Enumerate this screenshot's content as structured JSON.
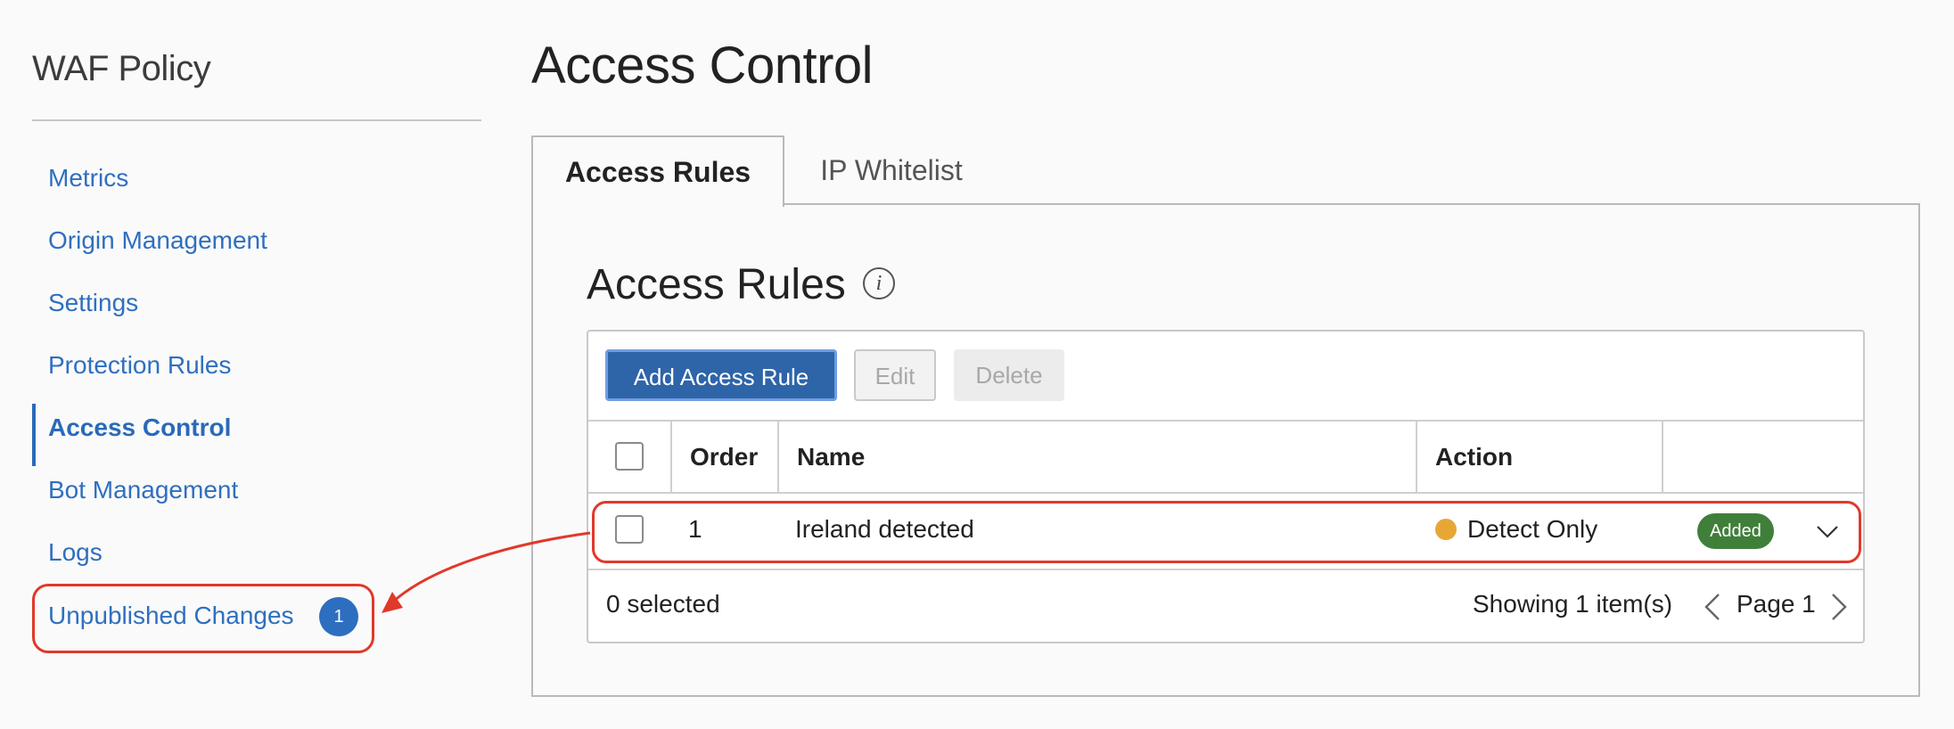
{
  "sidebar": {
    "title": "WAF Policy",
    "items": [
      {
        "label": "Metrics"
      },
      {
        "label": "Origin Management"
      },
      {
        "label": "Settings"
      },
      {
        "label": "Protection Rules"
      },
      {
        "label": "Access Control",
        "active": true
      },
      {
        "label": "Bot Management"
      },
      {
        "label": "Logs"
      }
    ],
    "unpublished": {
      "label": "Unpublished Changes",
      "count": "1"
    }
  },
  "main": {
    "title": "Access Control",
    "tabs": [
      {
        "label": "Access Rules",
        "active": true
      },
      {
        "label": "IP Whitelist"
      }
    ],
    "section_title": "Access Rules",
    "info_icon": "i",
    "toolbar": {
      "add_label": "Add Access Rule",
      "edit_label": "Edit",
      "delete_label": "Delete"
    },
    "table": {
      "columns": [
        "Order",
        "Name",
        "Action"
      ],
      "rows": [
        {
          "order": "1",
          "name": "Ireland detected",
          "action": "Detect Only",
          "status": "Added"
        }
      ],
      "selected_text": "0 selected",
      "showing_text": "Showing 1 item(s)",
      "page_text": "Page 1"
    }
  },
  "colors": {
    "link": "#2f6fbf",
    "primary_button": "#2e64a8",
    "highlight": "#e0392a",
    "detect_dot": "#e8a735",
    "added_badge": "#3f7f3a",
    "count_badge": "#2d6ec0"
  },
  "icons": [
    "info-icon",
    "chevron-down-icon",
    "chevron-left-icon",
    "chevron-right-icon",
    "annotation-arrow"
  ]
}
